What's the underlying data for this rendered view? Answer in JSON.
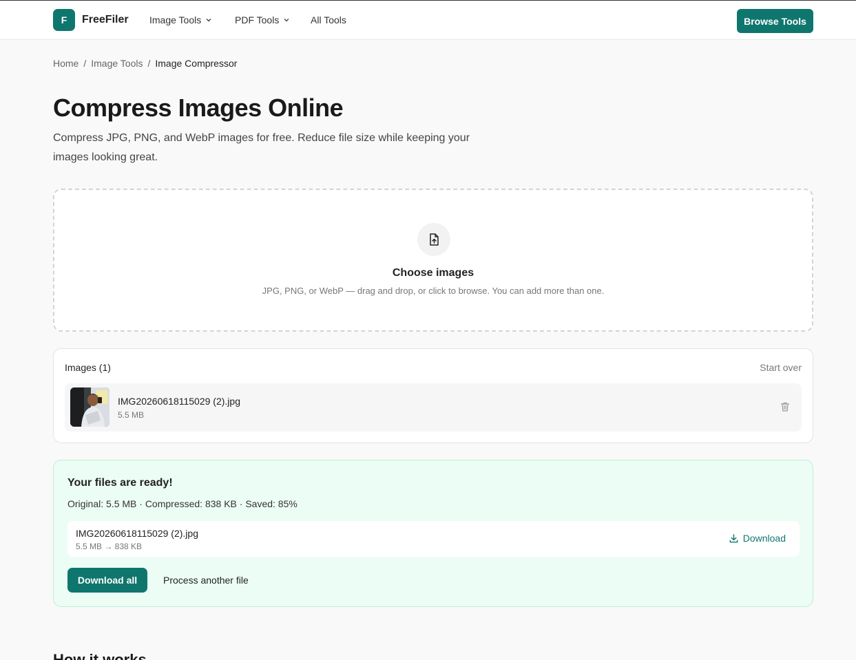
{
  "header": {
    "logo_letter": "F",
    "brand": "FreeFiler",
    "nav": [
      {
        "label": "Image Tools"
      },
      {
        "label": "PDF Tools"
      },
      {
        "label": "All Tools"
      }
    ],
    "cta_label": "Browse Tools",
    "accent_color": "#0f766e"
  },
  "breadcrumb": {
    "home": "Home",
    "sep1": "/",
    "section": "Image Tools",
    "sep2": "/",
    "current": "Image Compressor"
  },
  "page": {
    "title": "Compress Images Online",
    "subtitle": "Compress JPG, PNG, and WebP images for free. Reduce file size while keeping your images looking great."
  },
  "dropzone": {
    "icon": "file-upload-icon",
    "title": "Choose images",
    "hint": "JPG, PNG, or WebP — drag and drop, or click to browse. You can add more than one."
  },
  "images_panel": {
    "title": "Images (1)",
    "start_over": "Start over",
    "files": [
      {
        "name": "IMG20260618115029 (2).jpg",
        "size": "5.5 MB"
      }
    ]
  },
  "result_panel": {
    "title": "Your files are ready!",
    "stats": "Original: 5.5 MB · Compressed: 838 KB · Saved: 85%",
    "files": [
      {
        "name": "IMG20260618115029 (2).jpg",
        "sizes": "5.5 MB → 838 KB",
        "download_label": "Download"
      }
    ],
    "download_all_label": "Download all",
    "process_another_label": "Process another file",
    "background_color": "#ecfdf5"
  },
  "below_fold": {
    "heading": "How it works"
  }
}
